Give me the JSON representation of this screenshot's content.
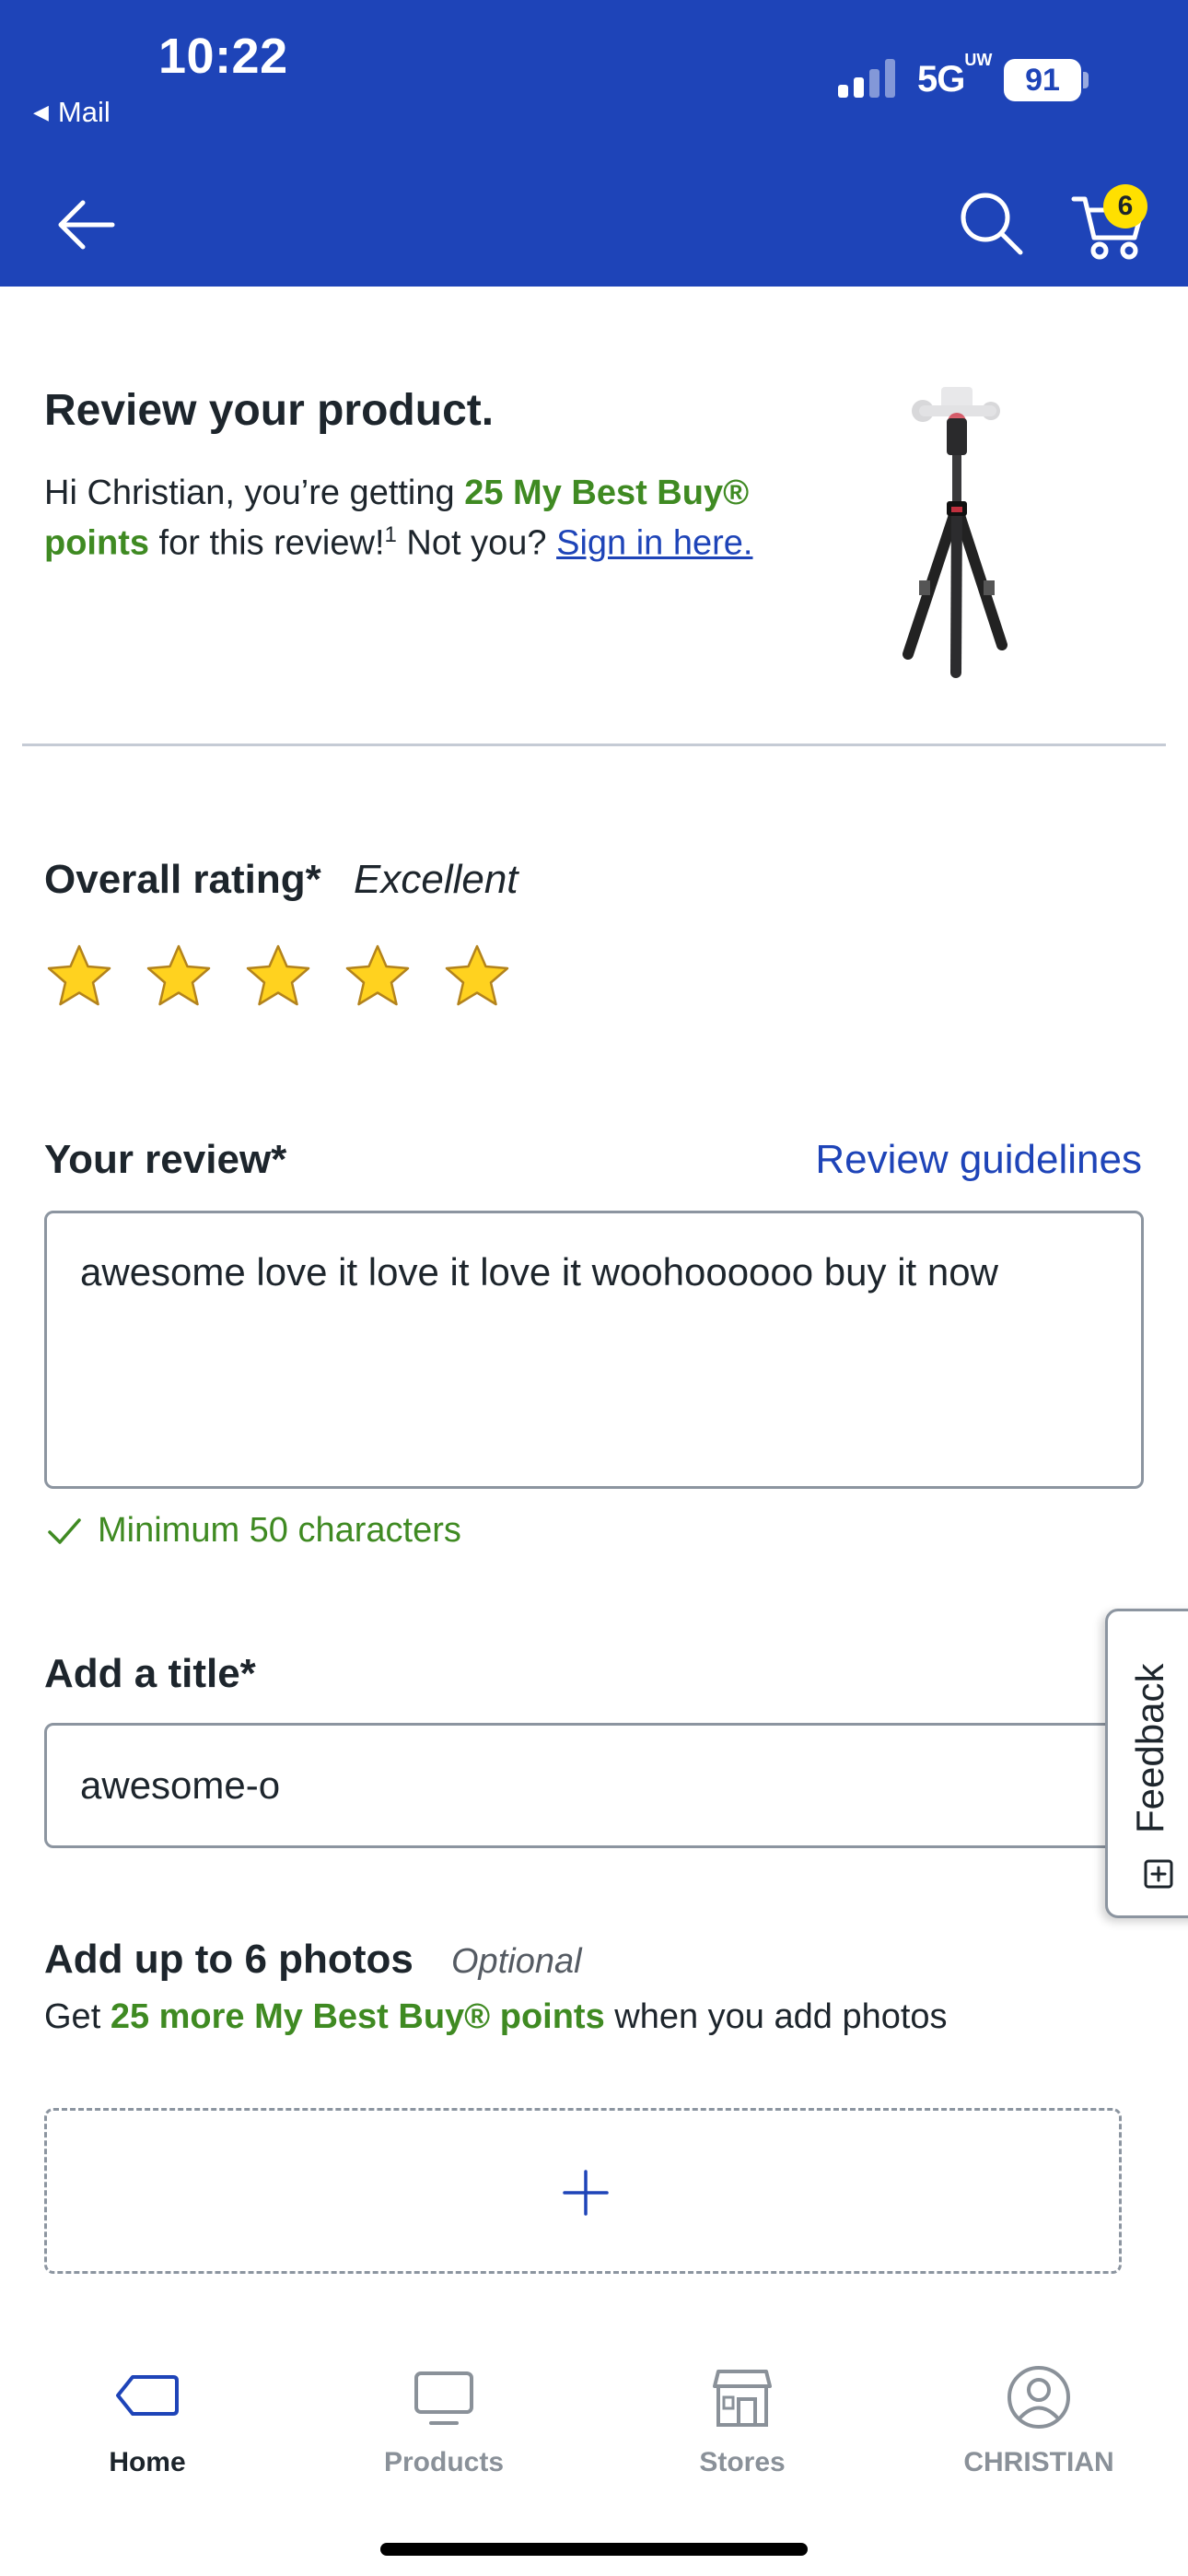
{
  "status_bar": {
    "time": "10:22",
    "back_app": "Mail",
    "network": "5G",
    "network_suffix": "UW",
    "battery": "91"
  },
  "header": {
    "cart_count": "6",
    "bg_color": "#1e44b8",
    "icons": [
      "back-arrow-icon",
      "search-icon",
      "cart-icon"
    ]
  },
  "product": {
    "heading": "Review your product.",
    "intro_prefix": "Hi Christian, you’re getting ",
    "points_text": "25 My Best Buy® points",
    "intro_mid": " for this review!",
    "footnote": "1",
    "not_you": " Not you? ",
    "sign_in_link": "Sign in here."
  },
  "rating": {
    "label": "Overall rating*",
    "value_text": "Excellent",
    "stars_filled": 5,
    "stars_total": 5
  },
  "review": {
    "label": "Your review*",
    "guidelines_link": "Review guidelines",
    "text": "awesome love it love it love it woohoooooo buy it now",
    "validation": "Minimum 50 characters"
  },
  "title_field": {
    "label": "Add a title*",
    "value": "awesome-o"
  },
  "feedback": {
    "label": "Feedback"
  },
  "photos": {
    "label": "Add up to 6 photos",
    "optional": "Optional",
    "sub_prefix": "Get ",
    "sub_points": "25 more My Best Buy® points",
    "sub_suffix": " when you add photos"
  },
  "bottom_nav": {
    "items": [
      {
        "label": "Home",
        "icon": "home-tag-icon",
        "active": true
      },
      {
        "label": "Products",
        "icon": "monitor-icon",
        "active": false
      },
      {
        "label": "Stores",
        "icon": "store-icon",
        "active": false
      },
      {
        "label": "CHRISTIAN",
        "icon": "account-icon",
        "active": false
      }
    ]
  },
  "colors": {
    "brand_blue": "#1e44b8",
    "points_green": "#3f8a22",
    "star_yellow": "#ffd21f",
    "badge_yellow": "#ffe000"
  }
}
